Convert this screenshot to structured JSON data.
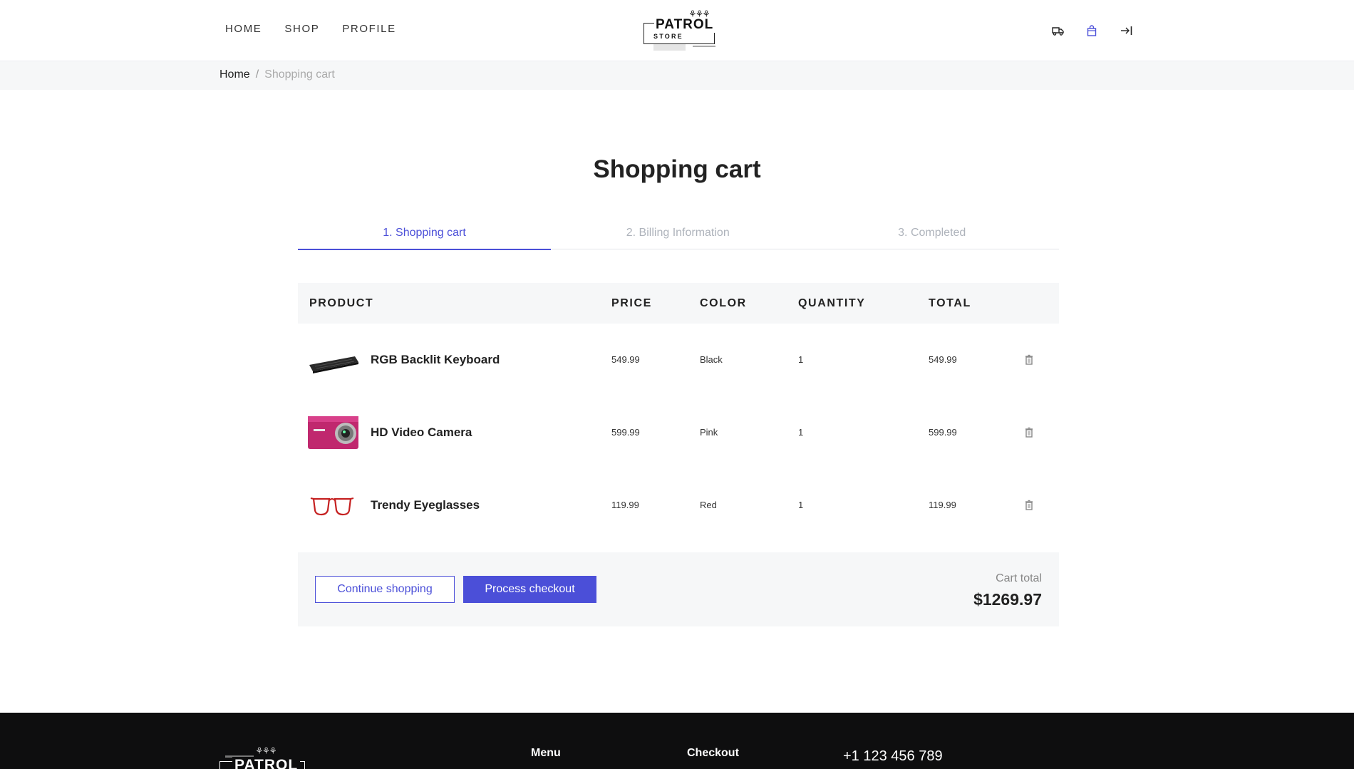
{
  "nav": {
    "home": "HOME",
    "shop": "SHOP",
    "profile": "PROFILE"
  },
  "logo": {
    "name": "PATROL",
    "sub": "STORE"
  },
  "header_icons": [
    "truck-icon",
    "shopping-bag-icon",
    "login-icon"
  ],
  "breadcrumb": {
    "home": "Home",
    "separator": "/",
    "current": "Shopping cart"
  },
  "page_title": "Shopping cart",
  "steps": [
    {
      "label": "1. Shopping cart",
      "active": true
    },
    {
      "label": "2. Billing Information",
      "active": false
    },
    {
      "label": "3. Completed",
      "active": false
    }
  ],
  "table": {
    "headers": {
      "product": "PRODUCT",
      "price": "PRICE",
      "color": "COLOR",
      "quantity": "QUANTITY",
      "total": "TOTAL"
    },
    "rows": [
      {
        "name": "RGB Backlit Keyboard",
        "price": "549.99",
        "color": "Black",
        "quantity": "1",
        "total": "549.99",
        "thumb": "keyboard-image"
      },
      {
        "name": "HD Video Camera",
        "price": "599.99",
        "color": "Pink",
        "quantity": "1",
        "total": "599.99",
        "thumb": "camera-image"
      },
      {
        "name": "Trendy Eyeglasses",
        "price": "119.99",
        "color": "Red",
        "quantity": "1",
        "total": "119.99",
        "thumb": "eyeglasses-image"
      }
    ]
  },
  "actions": {
    "continue": "Continue shopping",
    "checkout": "Process checkout"
  },
  "cart_total": {
    "label": "Cart total",
    "value": "$1269.97"
  },
  "footer": {
    "logo": "PATROL",
    "menu": "Menu",
    "checkout": "Checkout",
    "phone": "+1 123 456 789"
  },
  "colors": {
    "accent": "#4b4fd8",
    "footer_bg": "#0e0e0f",
    "muted_bg": "#f6f7f8"
  }
}
